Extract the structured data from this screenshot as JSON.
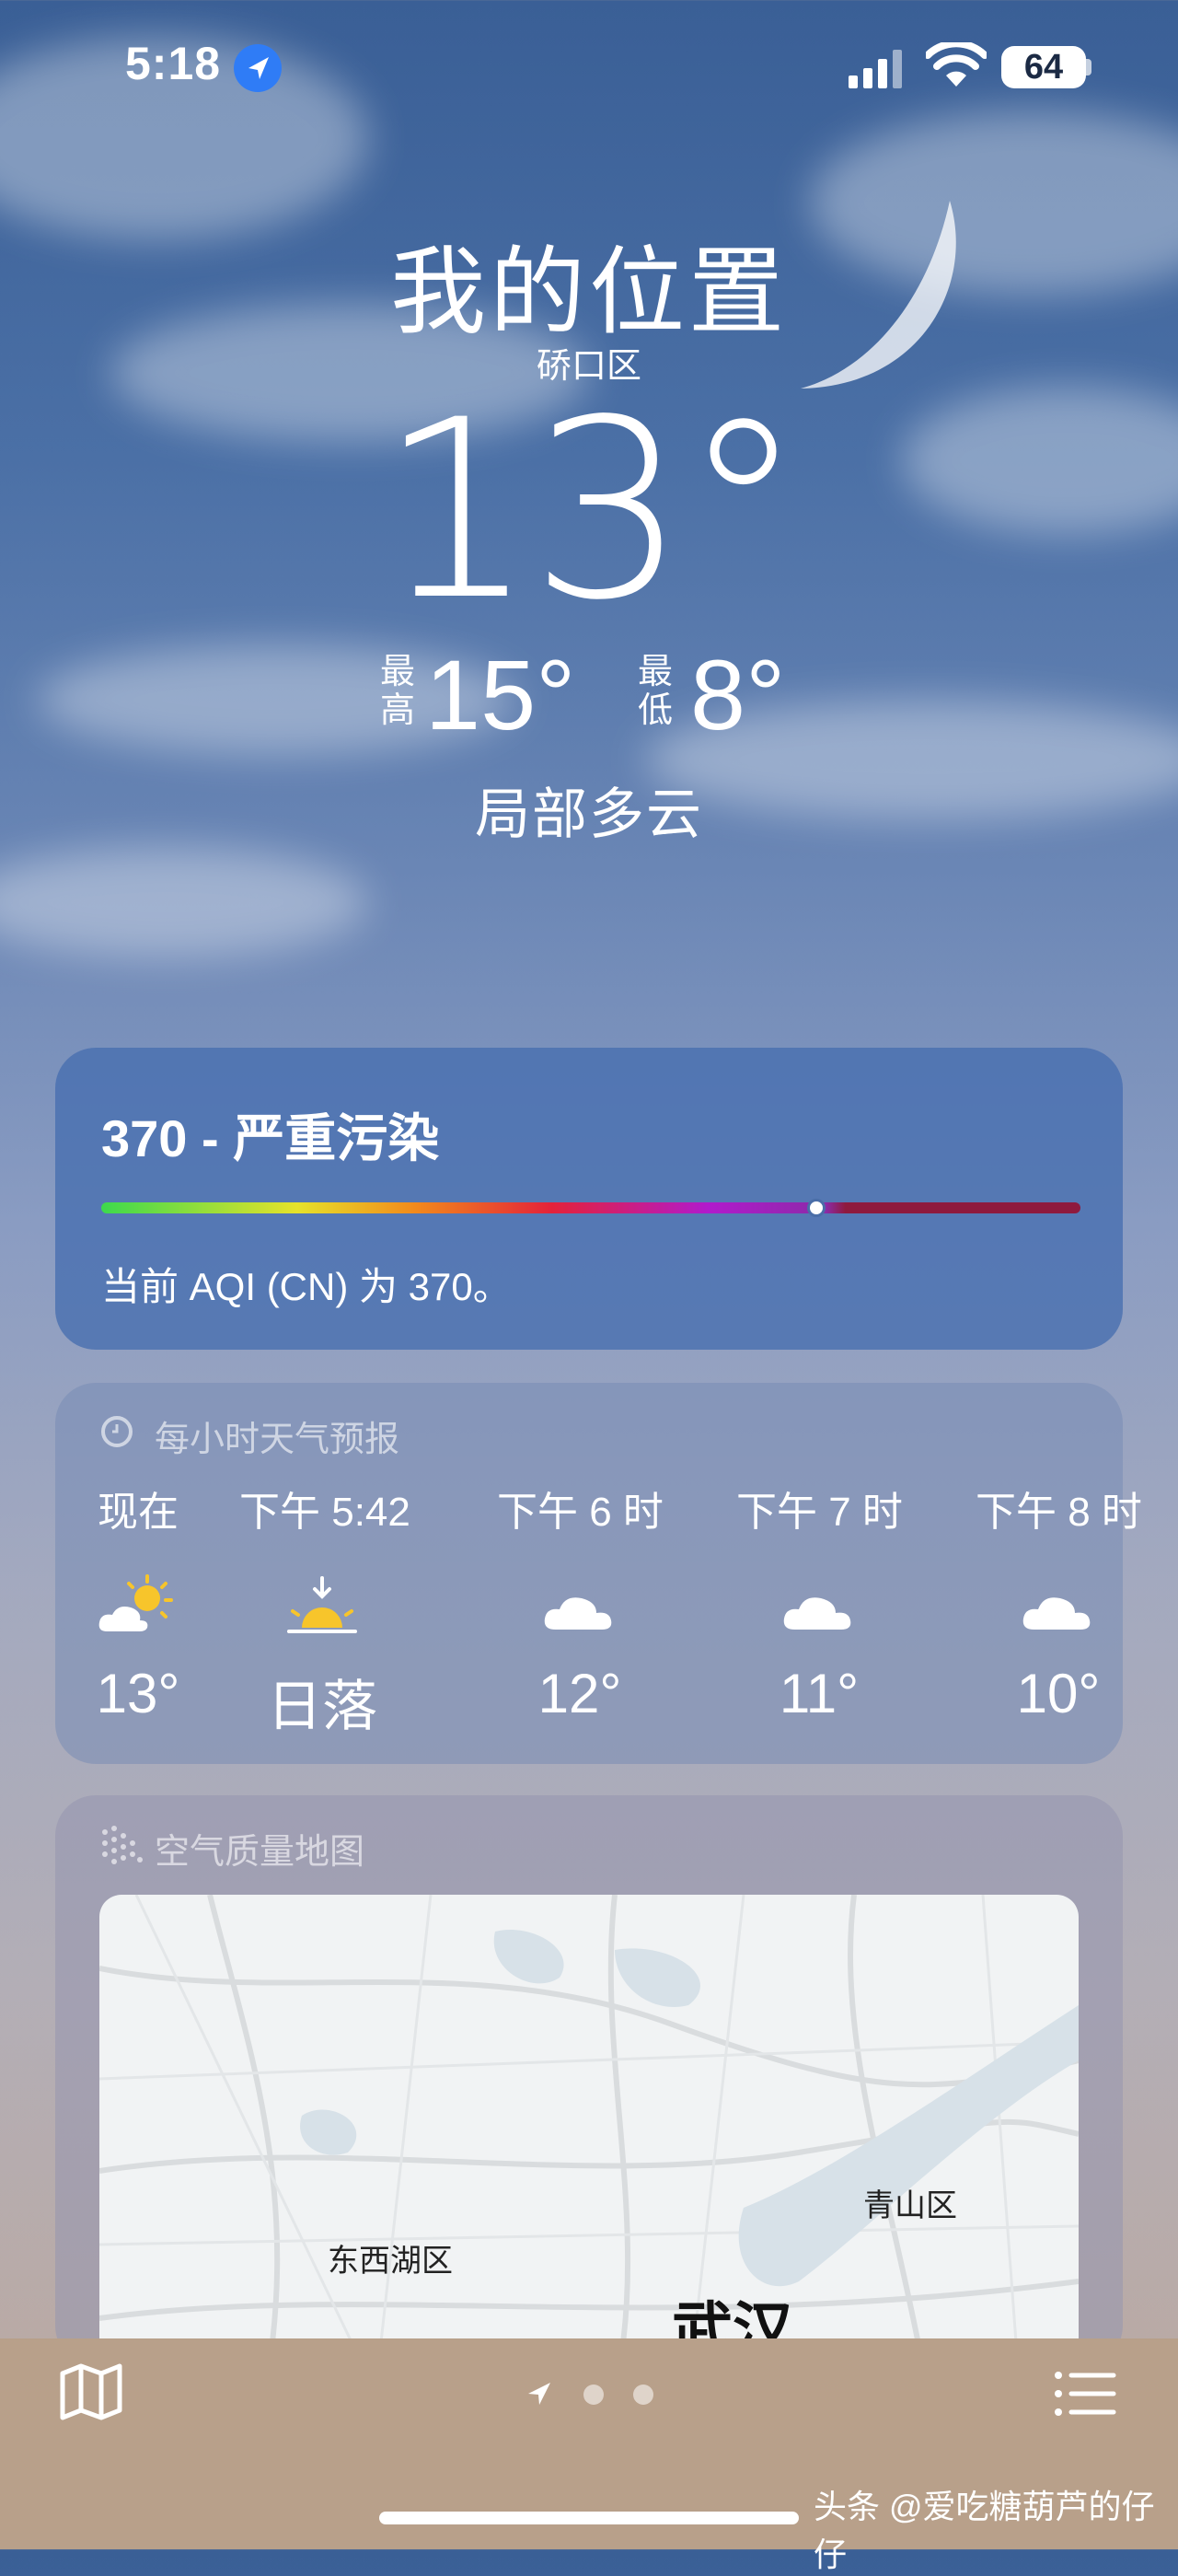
{
  "status_bar": {
    "time": "5:18",
    "battery": "64"
  },
  "header": {
    "location": "我的位置",
    "district": "硚口区",
    "temperature": "13°",
    "high_label_1": "最",
    "high_label_2": "高",
    "high": "15°",
    "low_label_1": "最",
    "low_label_2": "低",
    "low": "8°",
    "condition": "局部多云"
  },
  "aqi": {
    "title": "370 - 严重污染",
    "level_fraction": 0.73,
    "description": "当前 AQI (CN) 为 370。"
  },
  "hourly": {
    "header": "每小时天气预报",
    "items": [
      {
        "time": "现在",
        "icon": "partly-sunny-icon",
        "value": "13°"
      },
      {
        "time": "下午 5:42",
        "icon": "sunset-icon",
        "value": "日落"
      },
      {
        "time": "下午 6 时",
        "icon": "cloud-icon",
        "value": "12°"
      },
      {
        "time": "下午 7 时",
        "icon": "cloud-icon",
        "value": "11°"
      },
      {
        "time": "下午 8 时",
        "icon": "cloud-icon",
        "value": "10°"
      }
    ]
  },
  "air_map": {
    "header": "空气质量地图",
    "labels": {
      "district_1": "东西湖区",
      "district_2": "青山区",
      "city": "武汉"
    }
  },
  "watermark": "头条 @爱吃糖葫芦的仔仔",
  "colors": {
    "aqi_marker": "#ffffff",
    "accent_blue": "#2f7cf6"
  }
}
